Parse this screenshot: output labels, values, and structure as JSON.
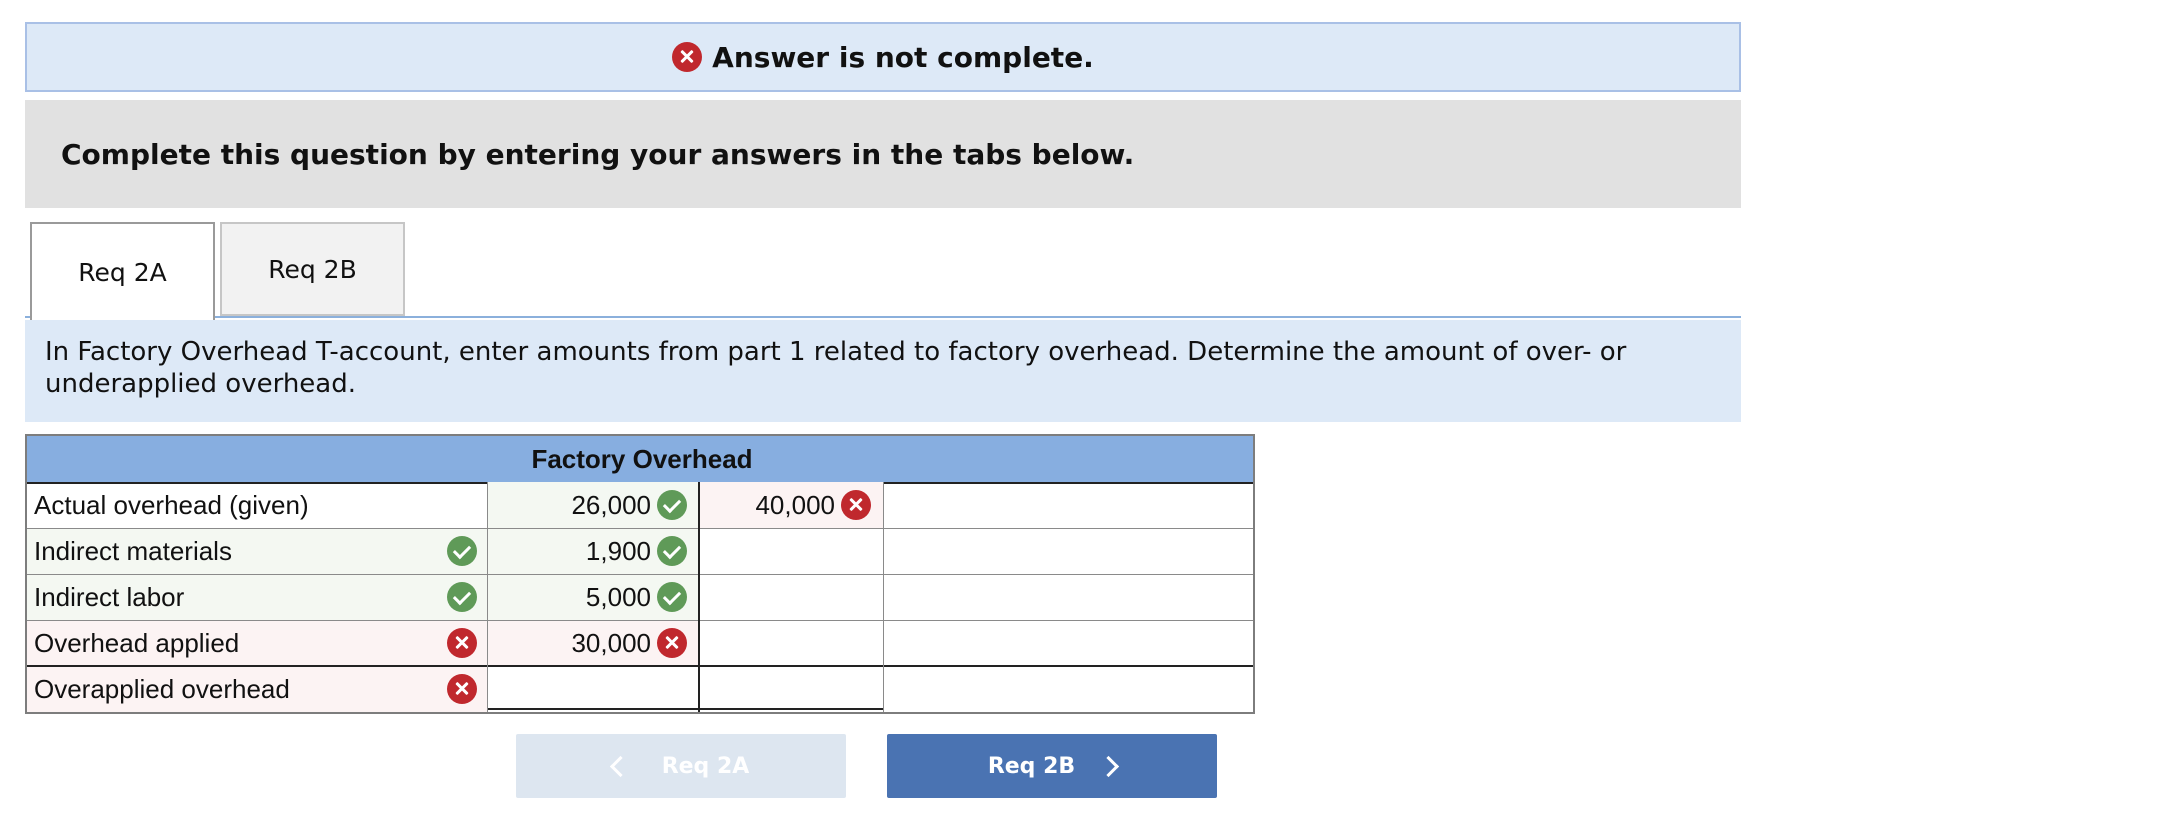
{
  "banner": {
    "icon": "x-circle-icon",
    "text": "Answer is not complete."
  },
  "instructions": {
    "text": "Complete this question by entering your answers in the tabs below."
  },
  "tabs": [
    {
      "label": "Req 2A",
      "active": true
    },
    {
      "label": "Req 2B",
      "active": false
    }
  ],
  "prompt": {
    "text": "In Factory Overhead T-account, enter amounts from part 1 related to factory overhead. Determine the amount of over- or underapplied overhead."
  },
  "t_account": {
    "title": "Factory Overhead",
    "rows": [
      {
        "label": "Actual overhead (given)",
        "label_status": null,
        "debit": "26,000",
        "debit_status": "correct",
        "credit": "40,000",
        "credit_status": "incorrect"
      },
      {
        "label": "Indirect materials",
        "label_status": "correct",
        "debit": "1,900",
        "debit_status": "correct",
        "credit": "",
        "credit_status": null
      },
      {
        "label": "Indirect labor",
        "label_status": "correct",
        "debit": "5,000",
        "debit_status": "correct",
        "credit": "",
        "credit_status": null
      },
      {
        "label": "Overhead applied",
        "label_status": "incorrect",
        "debit": "30,000",
        "debit_status": "incorrect",
        "credit": "",
        "credit_status": null
      },
      {
        "label": "Overapplied overhead",
        "label_status": "incorrect",
        "debit": "",
        "debit_status": null,
        "credit": "",
        "credit_status": null
      }
    ],
    "colors": {
      "correct": "#5f9a58",
      "incorrect": "#c0282d",
      "header": "#87aee0"
    }
  },
  "nav": {
    "prev_label": "Req 2A",
    "next_label": "Req 2B"
  }
}
